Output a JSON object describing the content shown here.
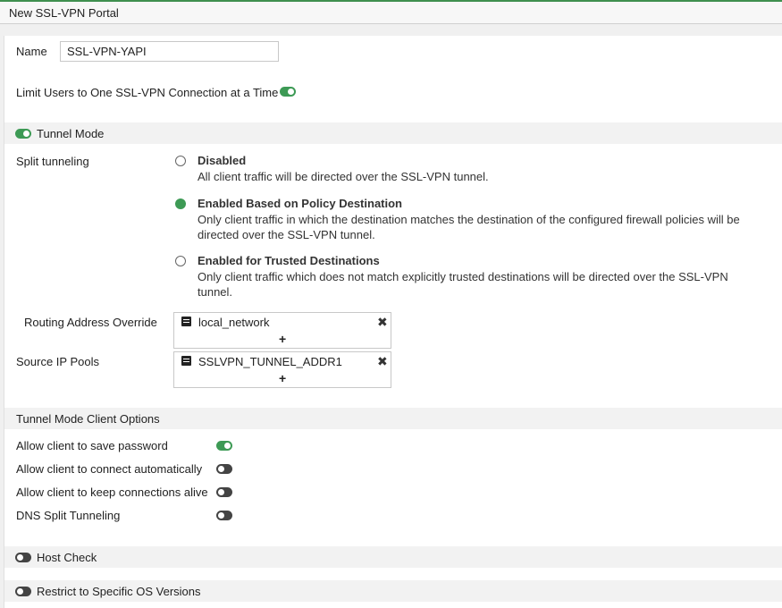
{
  "window": {
    "title": "New SSL-VPN Portal"
  },
  "form": {
    "name_label": "Name",
    "name_value": "SSL-VPN-YAPI",
    "limit_users_label": "Limit Users to One SSL-VPN Connection at a Time",
    "limit_users_enabled": true
  },
  "tunnel_mode": {
    "label": "Tunnel Mode",
    "enabled": true,
    "split_tunneling_label": "Split tunneling",
    "options": [
      {
        "title": "Disabled",
        "desc_lines": [
          "All client traffic will be directed over the SSL-VPN tunnel."
        ],
        "selected": false
      },
      {
        "title": "Enabled Based on Policy Destination",
        "desc_lines": [
          "Only client traffic in which the destination matches the destination of the configured firewall policies will be",
          "directed over the SSL-VPN tunnel."
        ],
        "selected": true
      },
      {
        "title": "Enabled for Trusted Destinations",
        "desc_lines": [
          "Only client traffic which does not match explicitly trusted destinations will be directed over the SSL-VPN",
          "tunnel."
        ],
        "selected": false
      }
    ],
    "routing_override_label": "Routing Address Override",
    "routing_override_entry": "local_network",
    "source_ip_pools_label": "Source IP Pools",
    "source_ip_pools_entry": "SSLVPN_TUNNEL_ADDR1",
    "remove_glyph": "✖",
    "add_glyph": "+"
  },
  "client_options": {
    "header": "Tunnel Mode Client Options",
    "items": [
      {
        "label": "Allow client to save password",
        "enabled": true
      },
      {
        "label": "Allow client to connect automatically",
        "enabled": false
      },
      {
        "label": "Allow client to keep connections alive",
        "enabled": false
      },
      {
        "label": "DNS Split Tunneling",
        "enabled": false
      }
    ]
  },
  "host_check": {
    "label": "Host Check",
    "enabled": false
  },
  "restrict_os": {
    "label": "Restrict to Specific OS Versions",
    "enabled": false
  },
  "colors": {
    "accent_green": "#3d9a55",
    "toggle_off": "#444444"
  }
}
